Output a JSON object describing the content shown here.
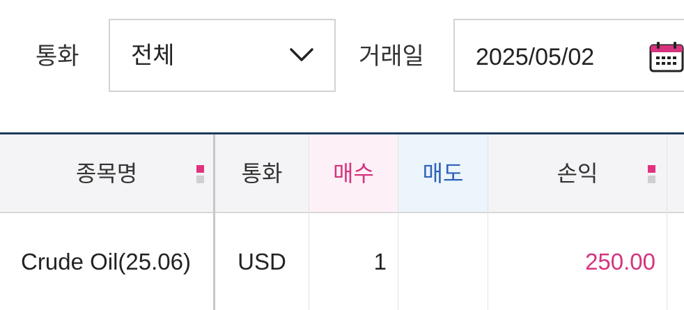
{
  "filters": {
    "currency_label": "통화",
    "currency_value": "전체",
    "trade_date_label": "거래일",
    "trade_date_value": "2025/05/02"
  },
  "table": {
    "headers": {
      "name": "종목명",
      "currency": "통화",
      "buy": "매수",
      "sell": "매도",
      "profit": "손익"
    },
    "rows": [
      {
        "name": "Crude Oil(25.06)",
        "currency": "USD",
        "buy": "1",
        "sell": "",
        "profit": "250.00"
      }
    ]
  },
  "colors": {
    "buy": "#d6337e",
    "sell": "#2f63b8",
    "header_rule": "#1d3b5c"
  },
  "icons": {
    "currency_dropdown": "chevron-down-icon",
    "date_picker": "calendar-icon"
  }
}
